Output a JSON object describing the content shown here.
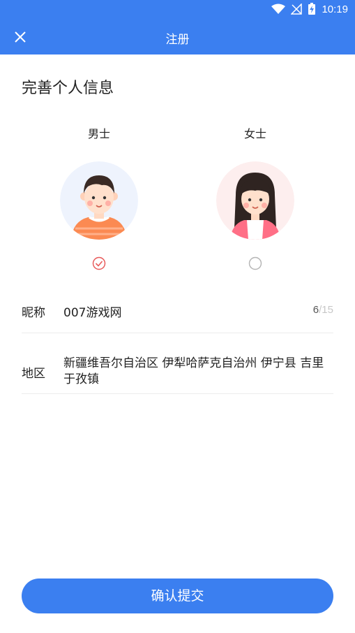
{
  "status_bar": {
    "time": "10:19"
  },
  "app_bar": {
    "title": "注册"
  },
  "page": {
    "title": "完善个人信息"
  },
  "gender": {
    "male_label": "男士",
    "female_label": "女士",
    "selected": "male"
  },
  "form": {
    "nickname_label": "昵称",
    "nickname_value": "007游戏网",
    "nickname_count": "6",
    "nickname_max": "/15",
    "region_label": "地区",
    "region_value": "新疆维吾尔自治区 伊犁哈萨克自治州 伊宁县 吉里于孜镇"
  },
  "submit_label": "确认提交",
  "colors": {
    "primary": "#3b7ff0",
    "check": "#e85a5a"
  }
}
